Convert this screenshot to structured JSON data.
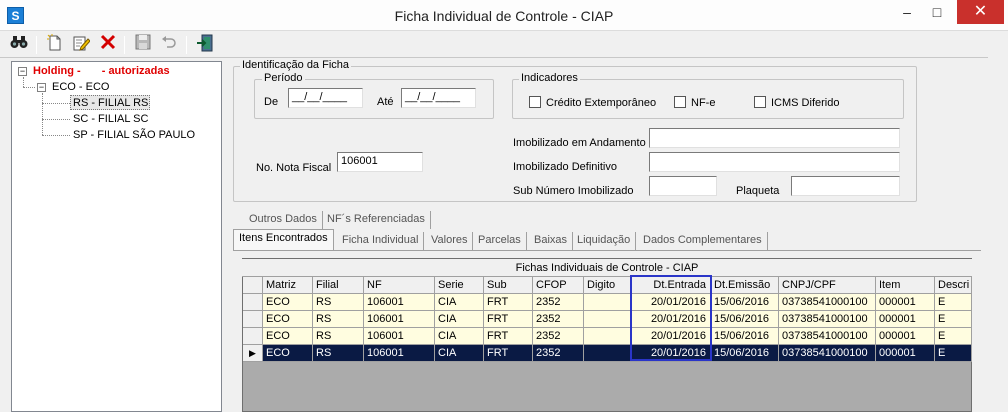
{
  "window": {
    "icon": "S",
    "title": "Ficha Individual de Controle - CIAP",
    "minimize": "–",
    "maximize": "□",
    "close": "✕"
  },
  "toolbar": {
    "icons": [
      "binoculars-icon",
      "new-document-icon",
      "edit-icon",
      "delete-icon",
      "save-icon",
      "undo-icon",
      "exit-icon"
    ]
  },
  "tree": {
    "root": {
      "label_a": "Holding -",
      "label_b": "- autorizadas"
    },
    "company": "ECO - ECO",
    "branches": [
      "RS - FILIAL RS",
      "SC - FILIAL SC",
      "SP - FILIAL SÃO PAULO"
    ]
  },
  "ident": {
    "legend": "Identificação da Ficha",
    "periodo_legend": "Período",
    "de_label": "De",
    "de_value": "__/__/____",
    "ate_label": "Até",
    "ate_value": "__/__/____",
    "indicadores_legend": "Indicadores",
    "chk_credito": "Crédito Extemporâneo",
    "chk_nfe": "NF-e",
    "chk_icms": "ICMS Diferido",
    "nota_label": "No. Nota Fiscal",
    "nota_value": "106001",
    "imob_andamento_label": "Imobilizado em Andamento",
    "imob_definitivo_label": "Imobilizado Definitivo",
    "sub_numero_label": "Sub Número Imobilizado",
    "plaqueta_label": "Plaqueta"
  },
  "tabs_top": [
    "Outros Dados",
    "NF´s Referenciadas"
  ],
  "tabs_bottom": [
    "Itens Encontrados",
    "Ficha Individual",
    "Valores",
    "Parcelas",
    "Baixas",
    "Liquidação",
    "Dados Complementares"
  ],
  "grid": {
    "caption": "Fichas Individuais de Controle - CIAP",
    "columns": [
      "Matriz",
      "Filial",
      "NF",
      "Serie",
      "Sub",
      "CFOP",
      "Digito",
      "Dt.Entrada",
      "Dt.Emissão",
      "CNPJ/CPF",
      "Item",
      "Descri"
    ],
    "rows": [
      [
        "ECO",
        "RS",
        "106001",
        "CIA",
        "FRT",
        "2352",
        "",
        "20/01/2016",
        "15/06/2016",
        "03738541000100",
        "000001",
        "E"
      ],
      [
        "ECO",
        "RS",
        "106001",
        "CIA",
        "FRT",
        "2352",
        "",
        "20/01/2016",
        "15/06/2016",
        "03738541000100",
        "000001",
        "E"
      ],
      [
        "ECO",
        "RS",
        "106001",
        "CIA",
        "FRT",
        "2352",
        "",
        "20/01/2016",
        "15/06/2016",
        "03738541000100",
        "000001",
        "E"
      ],
      [
        "ECO",
        "RS",
        "106001",
        "CIA",
        "FRT",
        "2352",
        "",
        "20/01/2016",
        "15/06/2016",
        "03738541000100",
        "000001",
        "E"
      ]
    ],
    "selected_row": 3,
    "current_row_marker": "▶"
  }
}
